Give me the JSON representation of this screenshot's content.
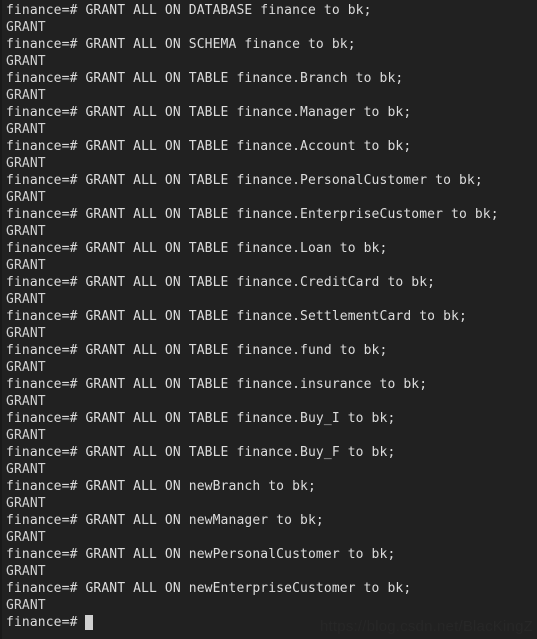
{
  "terminal": {
    "app": "psql",
    "background_color": "#212121",
    "foreground_color": "#d8d8d8",
    "cursor_color": "#d0d0d0",
    "prompt": "finance=# ",
    "font_size_px": 13,
    "line_height_px": 17,
    "columns": 64,
    "rows": 38,
    "lines": [
      {
        "type": "command",
        "text": "finance=# GRANT ALL ON DATABASE finance to bk;"
      },
      {
        "type": "output",
        "text": "GRANT"
      },
      {
        "type": "command",
        "text": "finance=# GRANT ALL ON SCHEMA finance to bk;"
      },
      {
        "type": "output",
        "text": "GRANT"
      },
      {
        "type": "command",
        "text": "finance=# GRANT ALL ON TABLE finance.Branch to bk;"
      },
      {
        "type": "output",
        "text": "GRANT"
      },
      {
        "type": "command",
        "text": "finance=# GRANT ALL ON TABLE finance.Manager to bk;"
      },
      {
        "type": "output",
        "text": "GRANT"
      },
      {
        "type": "command",
        "text": "finance=# GRANT ALL ON TABLE finance.Account to bk;"
      },
      {
        "type": "output",
        "text": "GRANT"
      },
      {
        "type": "command",
        "text": "finance=# GRANT ALL ON TABLE finance.PersonalCustomer to bk;"
      },
      {
        "type": "output",
        "text": "GRANT"
      },
      {
        "type": "command",
        "text": "finance=# GRANT ALL ON TABLE finance.EnterpriseCustomer to bk;"
      },
      {
        "type": "output",
        "text": "GRANT"
      },
      {
        "type": "command",
        "text": "finance=# GRANT ALL ON TABLE finance.Loan to bk;"
      },
      {
        "type": "output",
        "text": "GRANT"
      },
      {
        "type": "command",
        "text": "finance=# GRANT ALL ON TABLE finance.CreditCard to bk;"
      },
      {
        "type": "output",
        "text": "GRANT"
      },
      {
        "type": "command",
        "text": "finance=# GRANT ALL ON TABLE finance.SettlementCard to bk;"
      },
      {
        "type": "output",
        "text": "GRANT"
      },
      {
        "type": "command",
        "text": "finance=# GRANT ALL ON TABLE finance.fund to bk;"
      },
      {
        "type": "output",
        "text": "GRANT"
      },
      {
        "type": "command",
        "text": "finance=# GRANT ALL ON TABLE finance.insurance to bk;"
      },
      {
        "type": "output",
        "text": "GRANT"
      },
      {
        "type": "command",
        "text": "finance=# GRANT ALL ON TABLE finance.Buy_I to bk;"
      },
      {
        "type": "output",
        "text": "GRANT"
      },
      {
        "type": "command",
        "text": "finance=# GRANT ALL ON TABLE finance.Buy_F to bk;"
      },
      {
        "type": "output",
        "text": "GRANT"
      },
      {
        "type": "command",
        "text": "finance=# GRANT ALL ON newBranch to bk;"
      },
      {
        "type": "output",
        "text": "GRANT"
      },
      {
        "type": "command",
        "text": "finance=# GRANT ALL ON newManager to bk;"
      },
      {
        "type": "output",
        "text": "GRANT"
      },
      {
        "type": "command",
        "text": "finance=# GRANT ALL ON newPersonalCustomer to bk;"
      },
      {
        "type": "output",
        "text": "GRANT"
      },
      {
        "type": "command",
        "text": "finance=# GRANT ALL ON newEnterpriseCustomer to bk;"
      },
      {
        "type": "output",
        "text": "GRANT"
      }
    ],
    "current_line": {
      "prompt": "finance=# ",
      "input_value": "",
      "cursor_visible": true
    }
  },
  "watermark": {
    "text": "https://blog.csdn.net/BlacKingZ",
    "color": "#272727"
  }
}
